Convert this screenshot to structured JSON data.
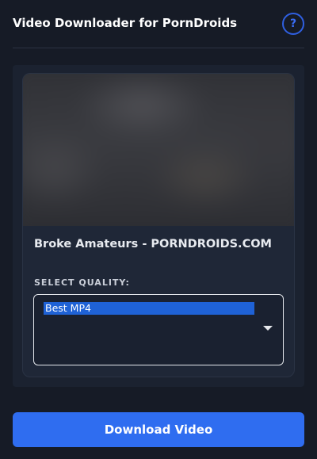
{
  "header": {
    "title": "Video Downloader for PornDroids",
    "help_label": "?"
  },
  "video": {
    "title": "Broke Amateurs - PORNDROIDS.COM"
  },
  "quality": {
    "label": "SELECT QUALITY:",
    "selected": "Best MP4",
    "icon": "chevron-down-icon"
  },
  "actions": {
    "download_label": "Download Video"
  },
  "colors": {
    "accent": "#2f6df0",
    "background": "#161b26",
    "selection": "#1f62d6"
  }
}
